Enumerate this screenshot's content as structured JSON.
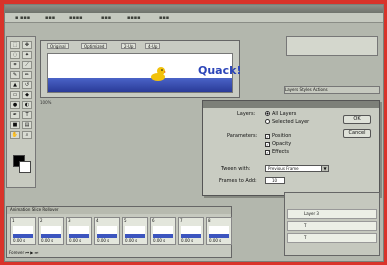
{
  "colors": {
    "desktop": "#d9332a",
    "water": "#2a3b98",
    "accent_text": "#2b44b8"
  },
  "document": {
    "tabs": [
      "Original",
      "Optimized",
      "2-Up",
      "4-Up"
    ],
    "canvas_text": "Quack!",
    "zoom_label": "100%"
  },
  "dialog": {
    "layers_label": "Layers:",
    "layer_options": [
      "All Layers",
      "Selected Layer"
    ],
    "layers_selected": "All Layers",
    "parameters_label": "Parameters:",
    "parameters": [
      "Position",
      "Opacity",
      "Effects"
    ],
    "tween_label": "Tween with:",
    "tween_value": "Previous Frame",
    "frames_label": "Frames to Add:",
    "frames_value": "10",
    "ok_label": "OK",
    "cancel_label": "Cancel"
  },
  "right_panel": {
    "tabs": [
      "Layers",
      "Styles",
      "Actions"
    ],
    "layer_names": [
      "Layer 3"
    ]
  },
  "animation": {
    "tabs": [
      "Animation",
      "Slice",
      "Rollover"
    ],
    "frames": [
      {
        "num": "1",
        "dur": "0.00 s"
      },
      {
        "num": "2",
        "dur": "0.00 s"
      },
      {
        "num": "3",
        "dur": "0.00 s"
      },
      {
        "num": "4",
        "dur": "0.00 s"
      },
      {
        "num": "5",
        "dur": "0.00 s"
      },
      {
        "num": "6",
        "dur": "0.00 s"
      },
      {
        "num": "7",
        "dur": "0.00 s"
      },
      {
        "num": "8",
        "dur": "0.00 s"
      }
    ],
    "loop_label": "Forever"
  }
}
